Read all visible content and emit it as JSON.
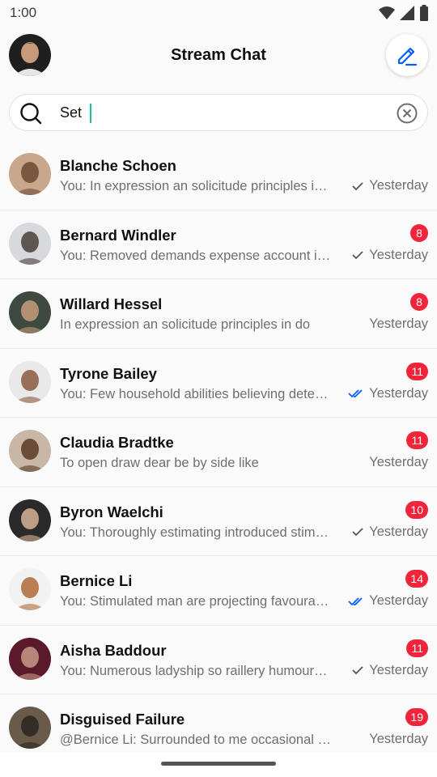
{
  "status_bar": {
    "time": "1:00"
  },
  "header": {
    "title": "Stream Chat"
  },
  "search": {
    "value": "Set"
  },
  "channels": [
    {
      "name": "Blanche Schoen",
      "preview": "You: In expression an solicitude principles in do",
      "time": "Yesterday",
      "status": "read-check",
      "badge": null,
      "avatar_bg": "#c9a78c",
      "avatar_fg": "#6b4a35"
    },
    {
      "name": "Bernard Windler",
      "preview": "You: Removed demands expense account in as",
      "time": "Yesterday",
      "status": "read-check",
      "badge": "8",
      "avatar_bg": "#d7d9dc",
      "avatar_fg": "#4b3e38"
    },
    {
      "name": "Willard Hessel",
      "preview": "In expression an solicitude principles in do",
      "time": "Yesterday",
      "status": null,
      "badge": "8",
      "avatar_bg": "#3e4a40",
      "avatar_fg": "#c79a7c"
    },
    {
      "name": "Tyrone Bailey",
      "preview": "You: Few household abilities believing determine",
      "time": "Yesterday",
      "status": "double-check",
      "badge": "11",
      "avatar_bg": "#e9e9e9",
      "avatar_fg": "#8a5a3e"
    },
    {
      "name": "Claudia Bradtke",
      "preview": "To open draw dear be by side like",
      "time": "Yesterday",
      "status": null,
      "badge": "11",
      "avatar_bg": "#c8b6a6",
      "avatar_fg": "#5a3a25"
    },
    {
      "name": "Byron Waelchi",
      "preview": "You: Thoroughly estimating introduced stimulated",
      "time": "Yesterday",
      "status": "read-check",
      "badge": "10",
      "avatar_bg": "#2a2a2a",
      "avatar_fg": "#d8b296"
    },
    {
      "name": "Bernice Li",
      "preview": "You: Stimulated man are projecting favourable",
      "time": "Yesterday",
      "status": "double-check",
      "badge": "14",
      "avatar_bg": "#f2f2f2",
      "avatar_fg": "#b06a3a"
    },
    {
      "name": "Aisha Baddour",
      "preview": "You: Numerous ladyship so raillery humoured goo",
      "time": "Yesterday",
      "status": "read-check",
      "badge": "11",
      "avatar_bg": "#5a1a2a",
      "avatar_fg": "#c89a8a"
    },
    {
      "name": "Disguised Failure",
      "preview": "@Bernice Li: Surrounded to me occasional pleasur",
      "time": "Yesterday",
      "status": null,
      "badge": "19",
      "avatar_bg": "#6a5a4a",
      "avatar_fg": "#2a2420"
    }
  ],
  "colors": {
    "accent": "#005fff",
    "badge": "#f0243a",
    "cursor": "#19c2a7",
    "read_check": "#555555",
    "double_check": "#005fff"
  }
}
